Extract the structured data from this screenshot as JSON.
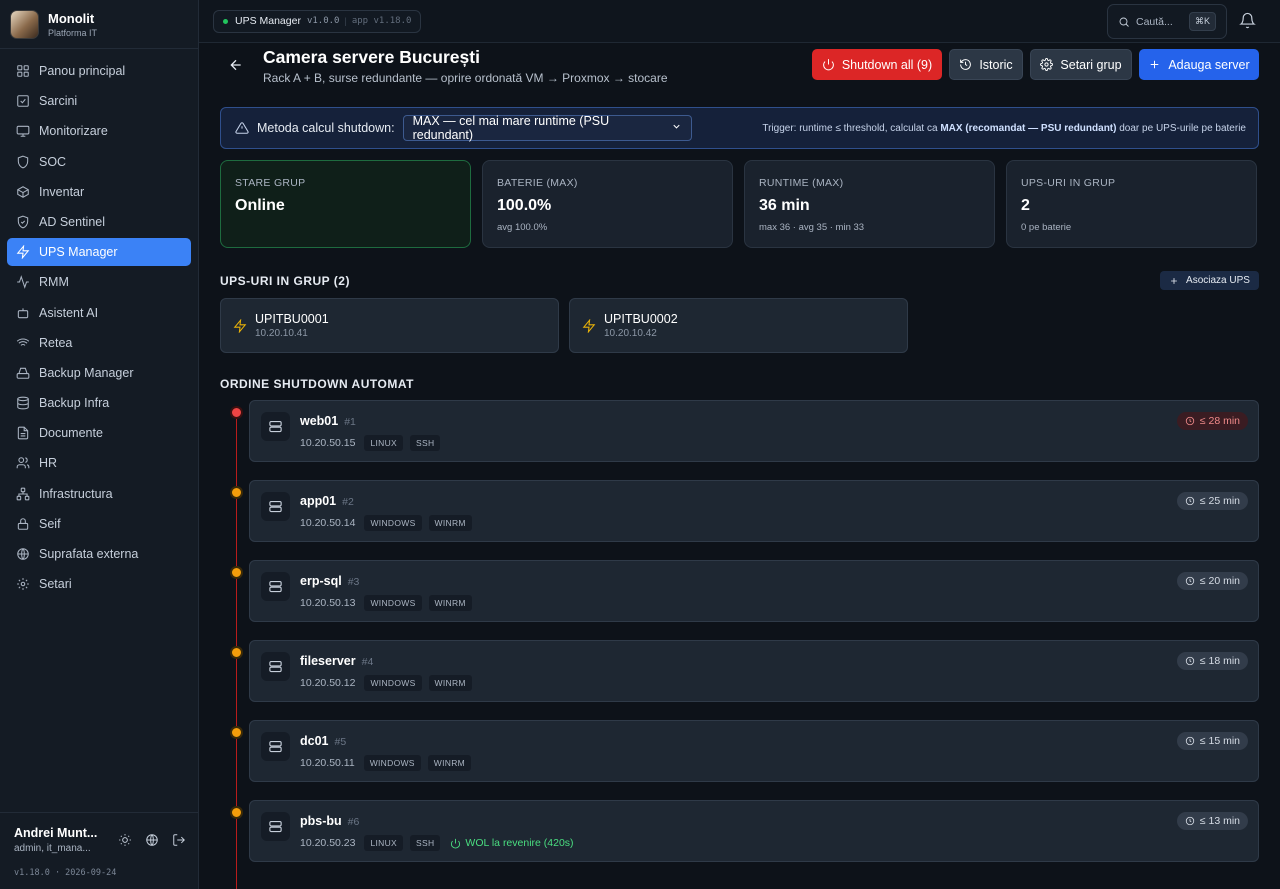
{
  "brand": {
    "title": "Monolit",
    "subtitle": "Platforma IT"
  },
  "sidebar": {
    "items": [
      {
        "label": "Panou principal",
        "icon": "grid-icon"
      },
      {
        "label": "Sarcini",
        "icon": "checkbox-icon"
      },
      {
        "label": "Monitorizare",
        "icon": "monitor-icon"
      },
      {
        "label": "SOC",
        "icon": "shield-icon"
      },
      {
        "label": "Inventar",
        "icon": "box-icon"
      },
      {
        "label": "AD Sentinel",
        "icon": "shield-check-icon"
      },
      {
        "label": "UPS Manager",
        "icon": "bolt-icon",
        "active": true
      },
      {
        "label": "RMM",
        "icon": "activity-icon"
      },
      {
        "label": "Asistent AI",
        "icon": "bot-icon"
      },
      {
        "label": "Retea",
        "icon": "wifi-icon"
      },
      {
        "label": "Backup Manager",
        "icon": "hdd-icon"
      },
      {
        "label": "Backup Infra",
        "icon": "database-icon"
      },
      {
        "label": "Documente",
        "icon": "file-icon"
      },
      {
        "label": "HR",
        "icon": "users-icon"
      },
      {
        "label": "Infrastructura",
        "icon": "network-icon"
      },
      {
        "label": "Seif",
        "icon": "lock-icon"
      },
      {
        "label": "Suprafata externa",
        "icon": "globe-icon"
      },
      {
        "label": "Setari",
        "icon": "gear-icon"
      }
    ]
  },
  "user": {
    "name": "Andrei Munt...",
    "role": "admin, it_mana...",
    "version": "v1.18.0 · 2026-09-24"
  },
  "topbar": {
    "app_name": "UPS Manager",
    "app_version": "v1.0.0",
    "separator": "|",
    "platform_version": "app v1.18.0",
    "search_placeholder": "Caută...",
    "shortcut": "⌘K"
  },
  "header": {
    "title": "Camera servere București",
    "subtitle": "Rack A + B, surse redundante — oprire ordonată VM → Proxmox → stocare",
    "buttons": {
      "shutdown_all": "Shutdown all (9)",
      "history": "Istoric",
      "group_settings": "Setari grup",
      "add_server": "Adauga server"
    }
  },
  "notice": {
    "label": "Metoda calcul shutdown:",
    "method_selected": "MAX — cel mai mare runtime (PSU redundant)",
    "trigger_prefix": "Trigger: runtime ≤ threshold, calculat ca ",
    "trigger_bold": "MAX (recomandat — PSU redundant)",
    "trigger_suffix": " doar pe UPS-urile pe baterie"
  },
  "stats": [
    {
      "label": "STARE GRUP",
      "value": "Online",
      "sub": ""
    },
    {
      "label": "BATERIE (MAX)",
      "value": "100.0%",
      "sub": "avg 100.0%"
    },
    {
      "label": "RUNTIME (MAX)",
      "value": "36 min",
      "sub": "max 36 · avg 35 · min 33"
    },
    {
      "label": "UPS-URI IN GRUP",
      "value": "2",
      "sub": "0 pe baterie"
    }
  ],
  "ups_section": {
    "title": "UPS-URI IN GRUP (2)",
    "associate": "Asociaza UPS"
  },
  "ups_units": [
    {
      "name": "UPITBU0001",
      "ip": "10.20.10.41"
    },
    {
      "name": "UPITBU0002",
      "ip": "10.20.10.42"
    }
  ],
  "shutdown_section": {
    "title": "ORDINE SHUTDOWN AUTOMAT"
  },
  "servers": [
    {
      "name": "web01",
      "order": "#1",
      "ip": "10.20.50.15",
      "tags": [
        "LINUX",
        "SSH"
      ],
      "runtime": "≤ 28 min",
      "status_color": "#ef4444",
      "wol": ""
    },
    {
      "name": "app01",
      "order": "#2",
      "ip": "10.20.50.14",
      "tags": [
        "WINDOWS",
        "WINRM"
      ],
      "runtime": "≤ 25 min",
      "status_color": "#f59e0b",
      "wol": ""
    },
    {
      "name": "erp-sql",
      "order": "#3",
      "ip": "10.20.50.13",
      "tags": [
        "WINDOWS",
        "WINRM"
      ],
      "runtime": "≤ 20 min",
      "status_color": "#f59e0b",
      "wol": ""
    },
    {
      "name": "fileserver",
      "order": "#4",
      "ip": "10.20.50.12",
      "tags": [
        "WINDOWS",
        "WINRM"
      ],
      "runtime": "≤ 18 min",
      "status_color": "#f59e0b",
      "wol": ""
    },
    {
      "name": "dc01",
      "order": "#5",
      "ip": "10.20.50.11",
      "tags": [
        "WINDOWS",
        "WINRM"
      ],
      "runtime": "≤ 15 min",
      "status_color": "#f59e0b",
      "wol": ""
    },
    {
      "name": "pbs-bu",
      "order": "#6",
      "ip": "10.20.50.23",
      "tags": [
        "LINUX",
        "SSH"
      ],
      "runtime": "≤ 13 min",
      "status_color": "#f59e0b",
      "wol": "WOL la revenire (420s)"
    }
  ]
}
